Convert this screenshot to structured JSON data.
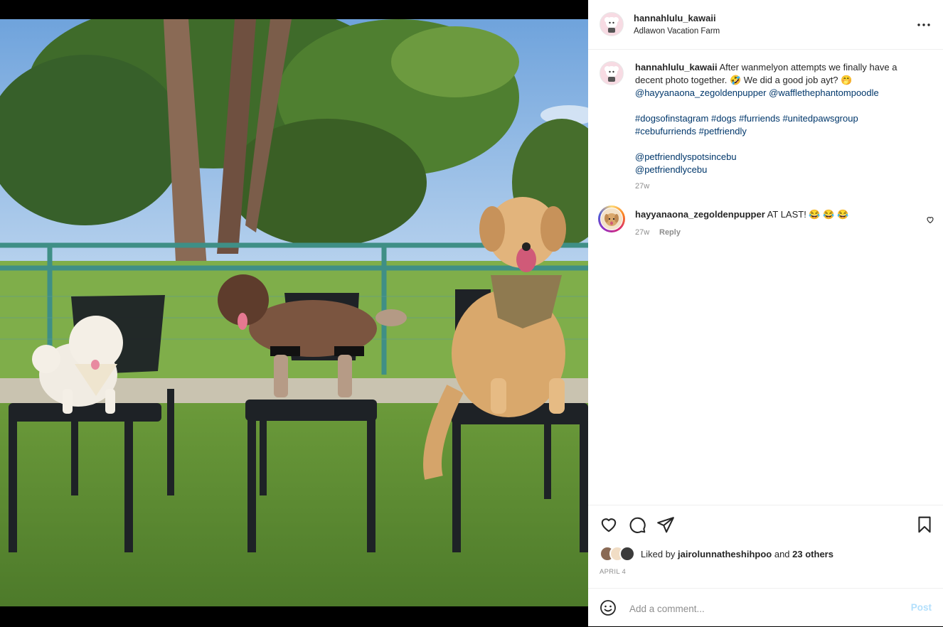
{
  "post": {
    "photo_alt": "Three dogs sitting on black chairs in a garden",
    "photo_icon": "photo-dogs-on-chairs"
  },
  "header": {
    "username": "hannahlulu_kawaii",
    "location": "Adlawon Vacation Farm",
    "more_icon": "more-horizontal-icon"
  },
  "caption": {
    "username": "hannahlulu_kawaii",
    "line1": "After wanmelyon attempts we finally have a decent photo together. 🤣 We did a good job ayt? 🤭",
    "mentions": [
      "@hayyanaona_zegoldenpupper",
      "@wafflethephantompoodle"
    ],
    "hashtags": [
      "#dogsofinstagram",
      "#dogs",
      "#furriends",
      "#unitedpawsgroup",
      "#cebufurriends",
      "#petfriendly"
    ],
    "mentions2": [
      "@petfriendlyspotsincebu",
      "@petfriendlycebu"
    ],
    "time": "27w"
  },
  "comment": {
    "username": "hayyanaona_zegoldenpupper",
    "text": "AT LAST! 😂 😂 😂",
    "time": "27w",
    "reply_label": "Reply"
  },
  "actions": {
    "liked_by_prefix": "Liked by",
    "liked_by_user": "jairolunnatheshihpoo",
    "and_label": "and",
    "others": "23 others",
    "date": "APRIL 4"
  },
  "add_comment": {
    "placeholder": "Add a comment...",
    "post_label": "Post"
  },
  "colors": {
    "link": "#00376b",
    "muted": "#8e8e8e",
    "post_disabled": "#b2dffc"
  }
}
